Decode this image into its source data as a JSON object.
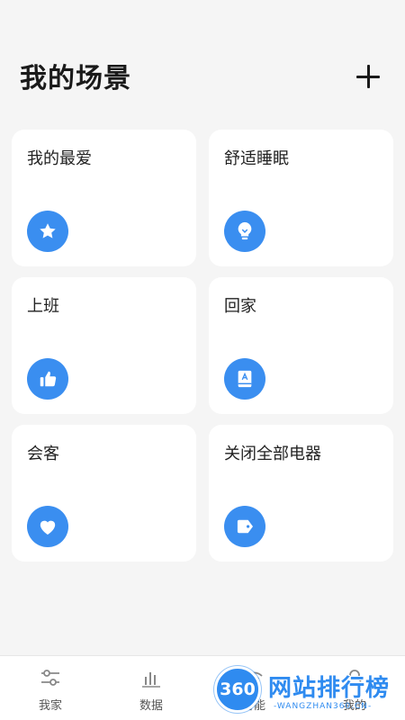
{
  "header": {
    "title": "我的场景",
    "add_icon": "plus-icon"
  },
  "scenes": [
    {
      "label": "我的最爱",
      "icon": "star-icon"
    },
    {
      "label": "舒适睡眠",
      "icon": "lightbulb-icon"
    },
    {
      "label": "上班",
      "icon": "thumbs-up-icon"
    },
    {
      "label": "回家",
      "icon": "book-icon"
    },
    {
      "label": "会客",
      "icon": "heart-icon"
    },
    {
      "label": "关闭全部电器",
      "icon": "tag-icon"
    }
  ],
  "tabs": [
    {
      "label": "我家",
      "icon": "sliders-icon"
    },
    {
      "label": "数据",
      "icon": "bar-chart-icon"
    },
    {
      "label": "智能",
      "icon": "wifi-icon"
    },
    {
      "label": "我的",
      "icon": "user-icon"
    }
  ],
  "colors": {
    "accent": "#3a8ef0",
    "background": "#f5f5f5",
    "card": "#ffffff"
  },
  "watermark": {
    "badge": "360",
    "text": "网站排行榜",
    "sub": "-WANGZHAN360.CN-"
  }
}
